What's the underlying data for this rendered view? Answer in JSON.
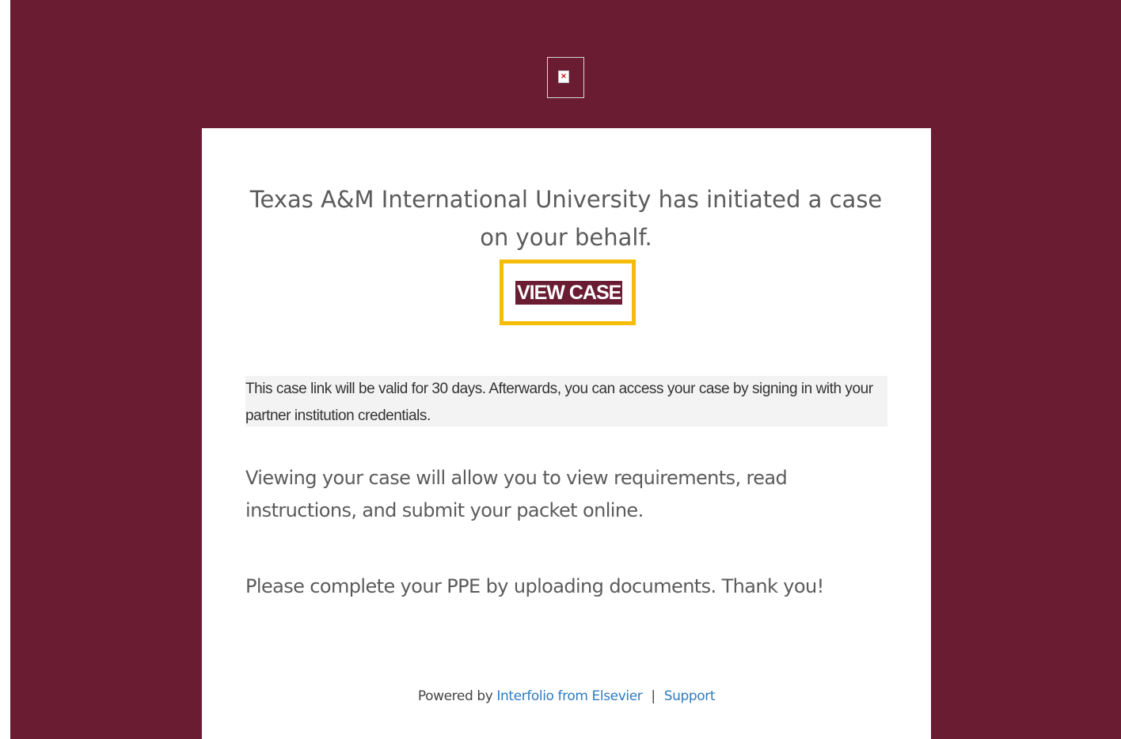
{
  "colors": {
    "brand_maroon": "#6a1c33",
    "highlight_yellow": "#f5bd08",
    "link_blue": "#2e7bbf"
  },
  "header": {
    "logo_icon": "broken-image-icon"
  },
  "email": {
    "headline": "Texas A&M International University has initiated a case on your behalf.",
    "cta_label": "VIEW CASE",
    "notice": "This case link will be valid for 30 days. Afterwards, you can access your case by signing in with your partner institution credentials.",
    "paragraph_1": "Viewing your case will allow you to view requirements, read instructions, and submit your packet online.",
    "paragraph_2": "Please complete your PPE by uploading documents. Thank you!"
  },
  "footer": {
    "powered_by": "Powered by",
    "interfolio_link": "Interfolio from Elsevier",
    "separator": "|",
    "support_link": "Support"
  }
}
